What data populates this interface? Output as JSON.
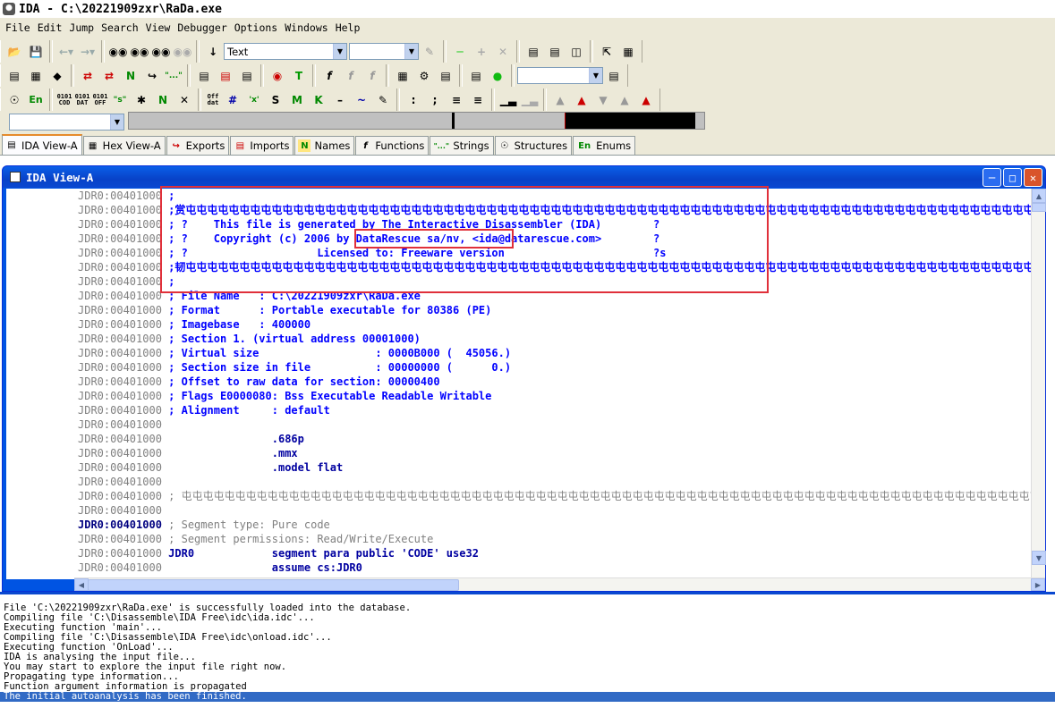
{
  "window": {
    "title": "IDA - C:\\20221909zxr\\RaDa.exe"
  },
  "menu": [
    "File",
    "Edit",
    "Jump",
    "Search",
    "View",
    "Debugger",
    "Options",
    "Windows",
    "Help"
  ],
  "toolbar": {
    "display_combo_value": "Text",
    "row1_icons": [
      "open-icon",
      "save-icon",
      "back-icon",
      "forward-icon",
      "search-binoculars-icon",
      "search-next-icon",
      "search-text-icon",
      "search-immediate-icon",
      "jump-icon"
    ],
    "row2_icons": [
      "list-icon",
      "code-icon",
      "diamond-icon",
      "xref-icon",
      "name-icon",
      "string-icon",
      "function-icon"
    ],
    "row3_labels": [
      "En",
      "0101 COD",
      "0101 DAT",
      "0101 OFF",
      "\"s\"",
      "N",
      "Off dat",
      "#",
      "'x'",
      "S",
      "M",
      "K"
    ]
  },
  "tabs": [
    {
      "label": "IDA View-A",
      "icon": "text-view-icon",
      "active": true
    },
    {
      "label": "Hex View-A",
      "icon": "hex-icon"
    },
    {
      "label": "Exports",
      "icon": "exports-icon"
    },
    {
      "label": "Imports",
      "icon": "imports-icon"
    },
    {
      "label": "Names",
      "icon": "names-icon"
    },
    {
      "label": "Functions",
      "icon": "functions-icon"
    },
    {
      "label": "Strings",
      "icon": "strings-icon"
    },
    {
      "label": "Structures",
      "icon": "structures-icon"
    },
    {
      "label": "Enums",
      "icon": "enums-icon"
    }
  ],
  "ida_view": {
    "title": "IDA View-A",
    "lines": [
      {
        "addr": "JDR0:00401000",
        "text": " ;",
        "cls": "cmt"
      },
      {
        "addr": "JDR0:00401000",
        "text": " ;赏屯屯屯屯屯屯屯屯屯屯屯屯屯屯屯屯屯屯屯屯屯屯屯屯屯屯屯屯屯屯屯屯屯屯屯屯屯屯屯屯屯屯屯屯屯屯屯屯屯屯屯屯屯屯屯屯屯屯屯屯屯屯屯屯屯屯屯屯屯屯屯屯屯屯屯屯屯屯屯屯屯屯屯屯屯屯屯屯屯屯屯屯屯屯屯屯屯屯屯屯屯屯屯屯屯屯屯屯屯屯屯屯屯屯屯屯屯屯屯屯屯屯屯屯屯屯屯屯屯屯屯屯屯屯屯屯屯屯屯屯屯屯屯屯屯屯屯屯屯屯屯屯屯屯屯屯屯屯屯屯屯屯屯屯屯屯屯",
        "cls": "cmt"
      },
      {
        "addr": "JDR0:00401000",
        "text": " ; ?    This file is generated by The Interactive Disassembler (IDA)        ?",
        "cls": "cmt"
      },
      {
        "addr": "JDR0:00401000",
        "text": " ; ?    Copyright (c) 2006 by DataRescue sa/nv, <ida@datarescue.com>        ?",
        "cls": "cmt"
      },
      {
        "addr": "JDR0:00401000",
        "text": " ; ?                    Licensed to: Freeware version                       ?s",
        "cls": "cmt"
      },
      {
        "addr": "JDR0:00401000",
        "text": " ;韧屯屯屯屯屯屯屯屯屯屯屯屯屯屯屯屯屯屯屯屯屯屯屯屯屯屯屯屯屯屯屯屯屯屯屯屯屯屯屯屯屯屯屯屯屯屯屯屯屯屯屯屯屯屯屯屯屯屯屯屯屯屯屯屯屯屯屯屯屯屯屯屯屯屯屯屯屯屯屯屯屯屯屯屯屯屯屯屯屯屯屯屯屯屯屯屯屯屯屯屯屯屯屯屯屯屯屯屯屯屯屯屯屯屯屯屯屯屯屯屯屯屯屯屯屯屯屯屯屯屯屯屯屯屯屯屯屯屯屯屯屯屯屯屯屯屯屯屯屯屯屯屯屯屯屯屯屯屯屯屯屯屯屯屯屯屯屯",
        "cls": "cmt"
      },
      {
        "addr": "JDR0:00401000",
        "text": " ;",
        "cls": "cmt"
      },
      {
        "addr": "JDR0:00401000",
        "text": " ; File Name   : C:\\20221909zxr\\RaDa.exe",
        "cls": "cmt"
      },
      {
        "addr": "JDR0:00401000",
        "text": " ; Format      : Portable executable for 80386 (PE)",
        "cls": "cmt"
      },
      {
        "addr": "JDR0:00401000",
        "text": " ; Imagebase   : 400000",
        "cls": "cmt"
      },
      {
        "addr": "JDR0:00401000",
        "text": " ; Section 1. (virtual address 00001000)",
        "cls": "cmt"
      },
      {
        "addr": "JDR0:00401000",
        "text": " ; Virtual size                  : 0000B000 (  45056.)",
        "cls": "cmt"
      },
      {
        "addr": "JDR0:00401000",
        "text": " ; Section size in file          : 00000000 (      0.)",
        "cls": "cmt"
      },
      {
        "addr": "JDR0:00401000",
        "text": " ; Offset to raw data for section: 00000400",
        "cls": "cmt"
      },
      {
        "addr": "JDR0:00401000",
        "text": " ; Flags E0000080: Bss Executable Readable Writable",
        "cls": "cmt"
      },
      {
        "addr": "JDR0:00401000",
        "text": " ; Alignment     : default",
        "cls": "cmt"
      },
      {
        "addr": "JDR0:00401000",
        "text": "",
        "cls": "cmt"
      },
      {
        "addr": "JDR0:00401000",
        "text": "                 .686p",
        "cls": "code"
      },
      {
        "addr": "JDR0:00401000",
        "text": "                 .mmx",
        "cls": "code"
      },
      {
        "addr": "JDR0:00401000",
        "text": "                 .model flat",
        "cls": "code"
      },
      {
        "addr": "JDR0:00401000",
        "text": "",
        "cls": "cmt"
      },
      {
        "addr": "JDR0:00401000",
        "text": " ; 屯屯屯屯屯屯屯屯屯屯屯屯屯屯屯屯屯屯屯屯屯屯屯屯屯屯屯屯屯屯屯屯屯屯屯屯屯屯屯屯屯屯屯屯屯屯屯屯屯屯屯屯屯屯屯屯屯屯屯屯屯屯屯屯屯屯屯屯屯屯屯屯屯屯屯屯屯屯屯屯屯屯屯屯屯屯屯屯屯屯屯屯屯屯屯屯屯屯屯屯屯屯屯屯屯屯屯屯屯屯屯屯屯屯屯屯屯屯屯屯屯屯屯屯屯屯屯屯屯屯屯屯屯屯屯屯屯屯屯屯屯屯屯屯屯屯屯屯屯屯屯屯屯屯屯屯屯屯屯屯屯屯屯屯屯屯屯",
        "cls": "grey"
      },
      {
        "addr": "JDR0:00401000",
        "text": "",
        "cls": "cmt"
      },
      {
        "addr": "JDR0:00401000",
        "text": " ; Segment type: Pure code",
        "cls": "grey",
        "cur": true
      },
      {
        "addr": "JDR0:00401000",
        "text": " ; Segment permissions: Read/Write/Execute",
        "cls": "grey"
      },
      {
        "addr": "JDR0:00401000",
        "text": " JDR0            segment para public 'CODE' use32",
        "cls": "code"
      },
      {
        "addr": "JDR0:00401000",
        "text": "                 assume cs:JDR0",
        "cls": "code"
      }
    ]
  },
  "output": {
    "lines": [
      "File 'C:\\20221909zxr\\RaDa.exe' is successfully loaded into the database.",
      "Compiling file 'C:\\Disassemble\\IDA Free\\idc\\ida.idc'...",
      "Executing function 'main'...",
      "Compiling file 'C:\\Disassemble\\IDA Free\\idc\\onload.idc'...",
      "Executing function 'OnLoad'...",
      "IDA is analysing the input file...",
      "You may start to explore the input file right now.",
      "Propagating type information...",
      "Function argument information is propagated",
      "The initial autoanalysis has been finished."
    ]
  },
  "colors": {
    "accent": "#0054e3",
    "highlight_box": "#e0303a",
    "selection": "#316ac5"
  }
}
